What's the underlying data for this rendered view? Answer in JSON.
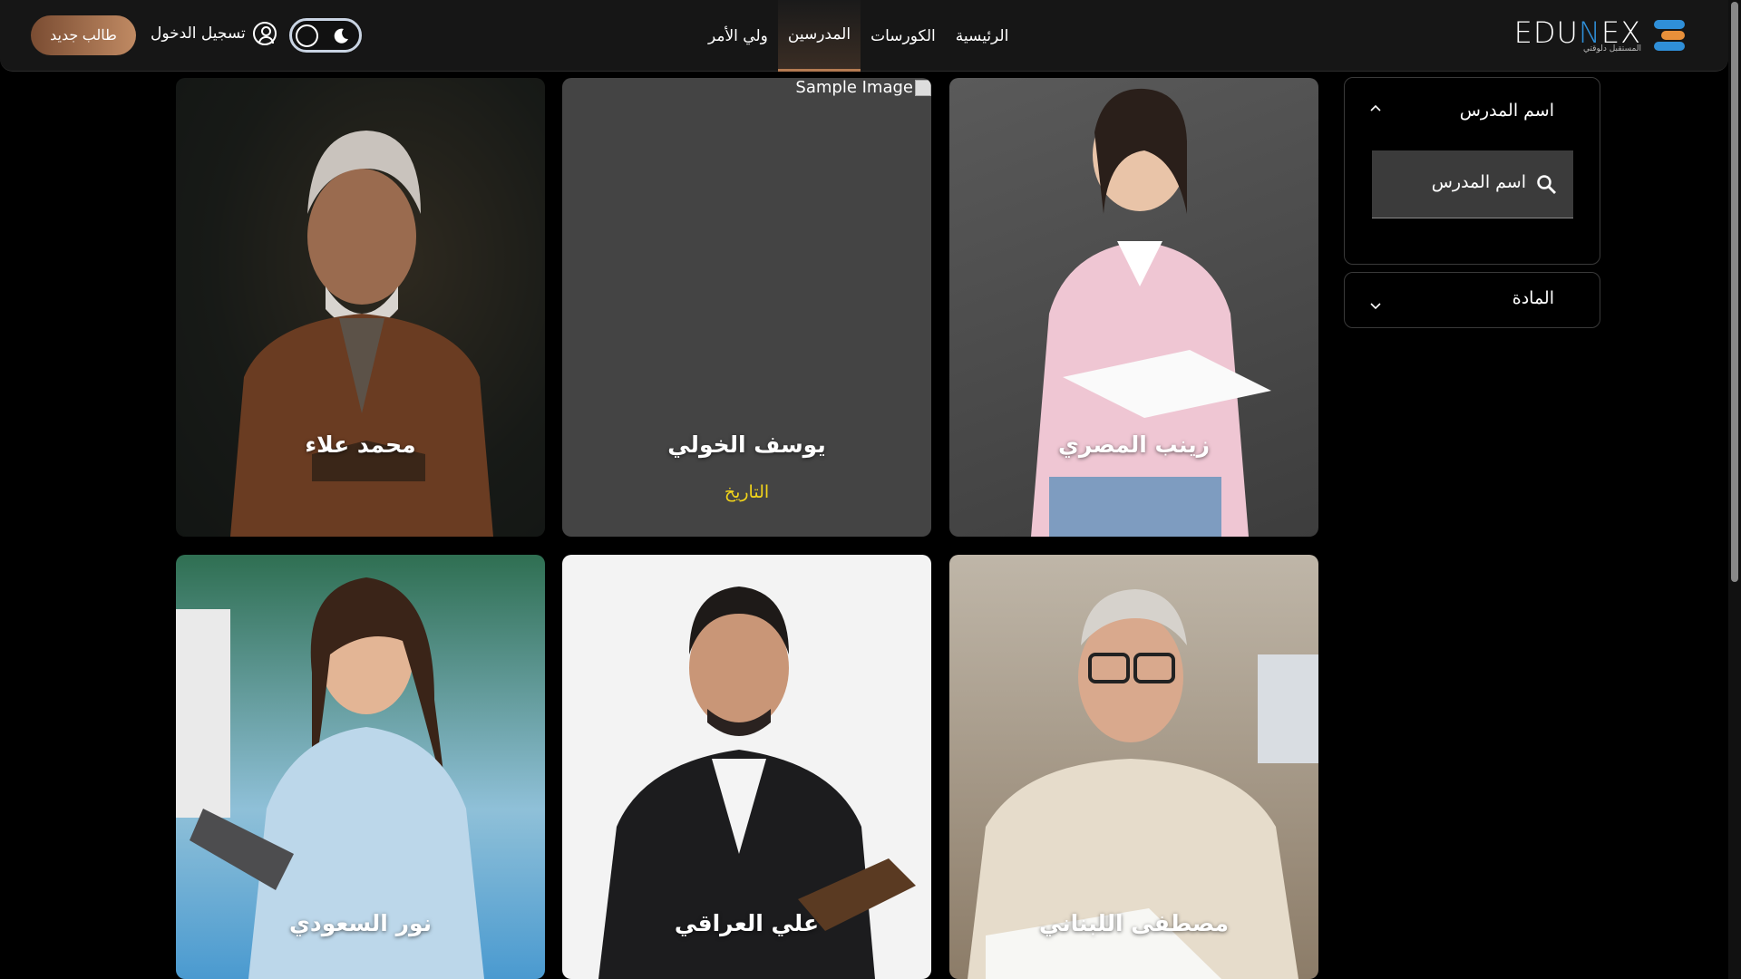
{
  "brand": {
    "name_left": "EDU",
    "name_n": "N",
    "name_right": "EX",
    "tagline": "المستقبل دلوقتي",
    "colors": {
      "blue": "#2f8fd8",
      "orange": "#e8903a",
      "accent": "#b57b52"
    }
  },
  "nav": {
    "items": [
      {
        "label": "الرئيسية",
        "active": false
      },
      {
        "label": "الكورسات",
        "active": false
      },
      {
        "label": "المدرسين",
        "active": true
      },
      {
        "label": "ولي الأمر",
        "active": false
      }
    ]
  },
  "header": {
    "login_label": "تسجيل الدخول",
    "new_student_label": "طالب جديد",
    "theme_toggle_icon": "moon-icon"
  },
  "filters": {
    "teacher_name_title": "اسم المدرس",
    "search_placeholder": "اسم المدرس",
    "subject_title": "المادة"
  },
  "teachers": [
    {
      "name": "زينب المصري",
      "subject": ""
    },
    {
      "name": "يوسف الخولي",
      "subject": "التاريخ",
      "image_alt": "Sample Image"
    },
    {
      "name": "محمد علاء",
      "subject": ""
    },
    {
      "name": "مصطفى اللبناني",
      "subject": ""
    },
    {
      "name": "علي العراقي",
      "subject": ""
    },
    {
      "name": "نور السعودي",
      "subject": ""
    }
  ]
}
